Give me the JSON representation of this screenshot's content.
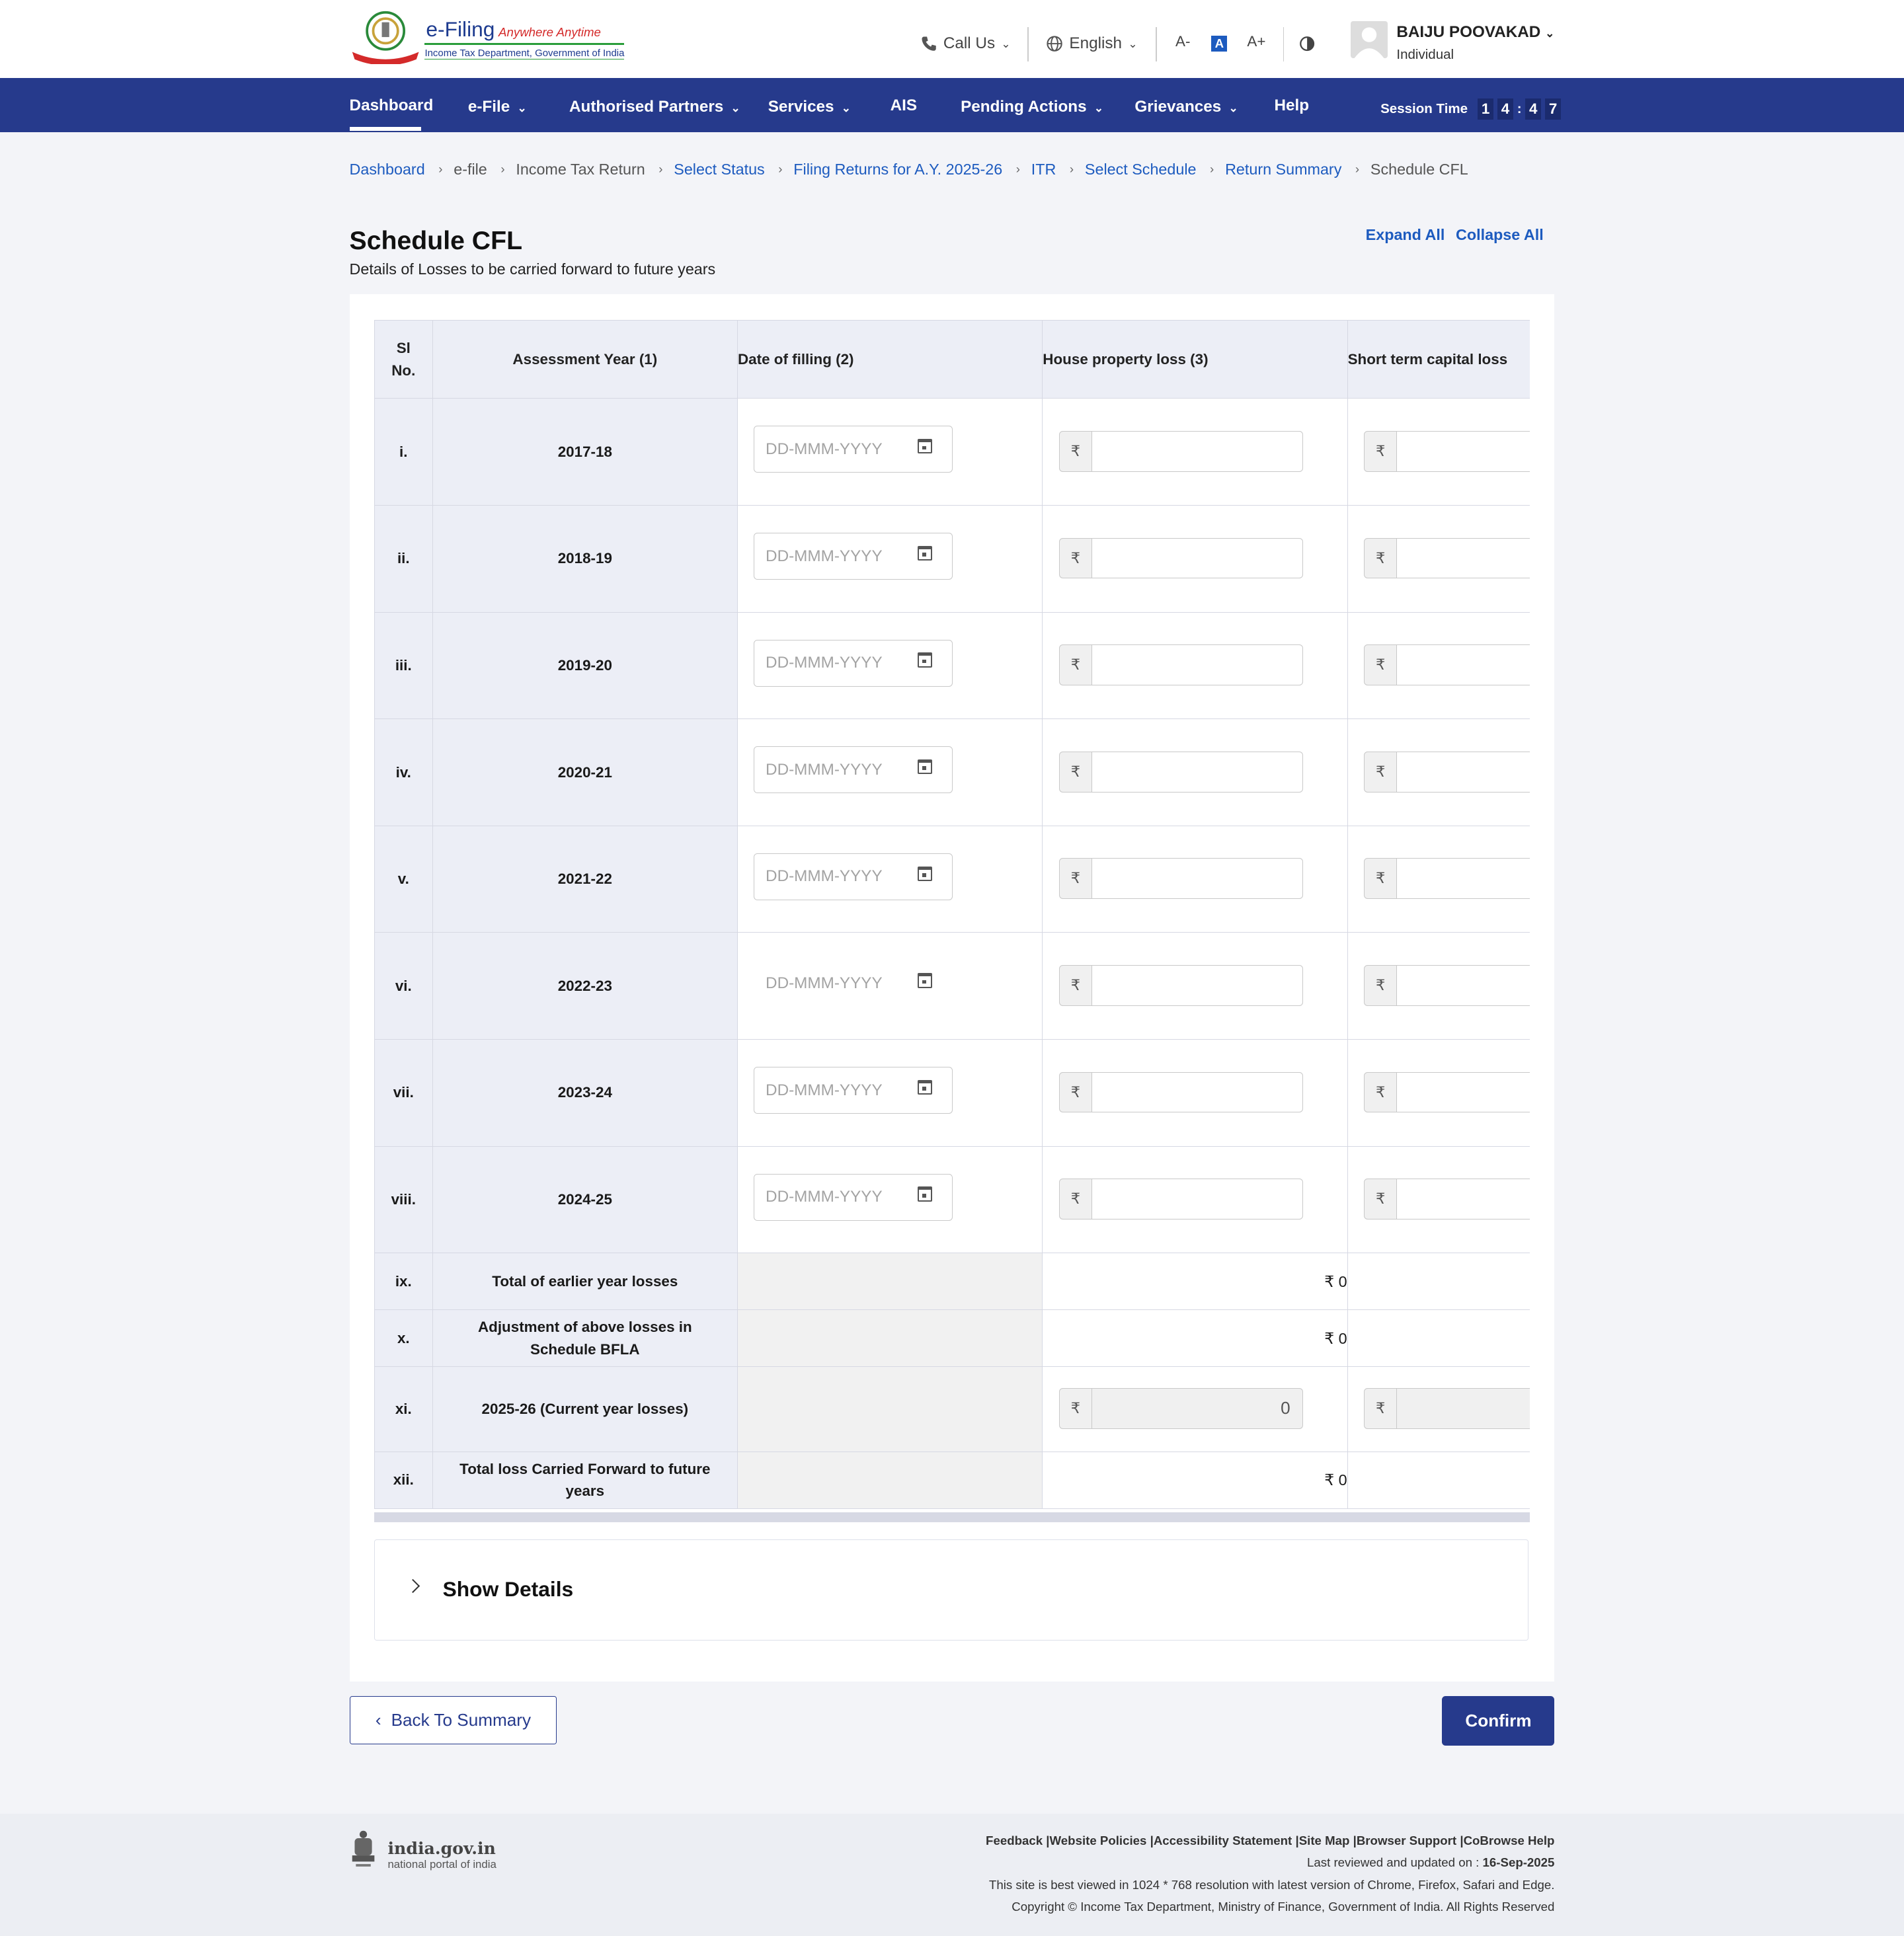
{
  "header": {
    "logo_title": "e-Filing",
    "logo_tagline": "Anywhere Anytime",
    "logo_subtitle": "Income Tax Department, Government of India",
    "call_us": "Call Us",
    "language": "English",
    "font_decrease": "A-",
    "font_normal": "A",
    "font_increase": "A+",
    "user_name": "BAIJU POOVAKAD",
    "user_role": "Individual"
  },
  "nav": {
    "items": [
      "Dashboard",
      "e-File",
      "Authorised Partners",
      "Services",
      "AIS",
      "Pending Actions",
      "Grievances",
      "Help"
    ],
    "session_label": "Session Time",
    "session_digits": [
      "1",
      "4",
      "4",
      "7"
    ]
  },
  "breadcrumb": [
    "Dashboard",
    "e-file",
    "Income Tax Return",
    "Select Status",
    "Filing Returns for A.Y. 2025-26",
    "ITR",
    "Select Schedule",
    "Return Summary",
    "Schedule CFL"
  ],
  "page": {
    "title": "Schedule CFL",
    "subtitle": "Details of Losses to be carried forward to future years",
    "expand_all": "Expand All",
    "collapse_all": "Collapse All"
  },
  "table": {
    "headers": [
      "Sl No.",
      "Assessment Year (1)",
      "Date of filling (2)",
      "House property loss (3)",
      "Short term capital loss"
    ],
    "date_placeholder": "DD-MMM-YYYY",
    "currency": "₹",
    "input_rows": [
      {
        "sl": "i.",
        "year": "2017-18"
      },
      {
        "sl": "ii.",
        "year": "2018-19"
      },
      {
        "sl": "iii.",
        "year": "2019-20"
      },
      {
        "sl": "iv.",
        "year": "2020-21"
      },
      {
        "sl": "v.",
        "year": "2021-22"
      },
      {
        "sl": "vi.",
        "year": "2022-23"
      },
      {
        "sl": "vii.",
        "year": "2023-24"
      },
      {
        "sl": "viii.",
        "year": "2024-25"
      }
    ],
    "summary_rows": [
      {
        "sl": "ix.",
        "label": "Total of earlier year losses",
        "house_property": "₹ 0"
      },
      {
        "sl": "x.",
        "label": "Adjustment of above losses in Schedule BFLA",
        "house_property": "₹ 0"
      },
      {
        "sl": "xi.",
        "label": "2025-26 (Current year losses)",
        "house_property": "0"
      },
      {
        "sl": "xii.",
        "label": "Total loss Carried Forward to future years",
        "house_property": "₹ 0"
      }
    ]
  },
  "show_details": "Show Details",
  "buttons": {
    "back": "Back To Summary",
    "confirm": "Confirm"
  },
  "footer": {
    "gov_name": "india.gov.in",
    "gov_sub": "national portal of india",
    "links": [
      "Feedback",
      "Website Policies",
      "Accessibility Statement",
      "Site Map",
      "Browser Support",
      "CoBrowse Help"
    ],
    "reviewed_label": "Last reviewed and updated on : ",
    "reviewed_date": "16-Sep-2025",
    "best_viewed": "This site is best viewed in 1024 * 768 resolution with latest version of Chrome, Firefox, Safari and Edge.",
    "copyright": "Copyright © Income Tax Department, Ministry of Finance, Government of India. All Rights Reserved"
  },
  "colors": {
    "nav_bg": "#263a8c",
    "link": "#1d5bbf",
    "page_bg": "#f3f4f8"
  }
}
